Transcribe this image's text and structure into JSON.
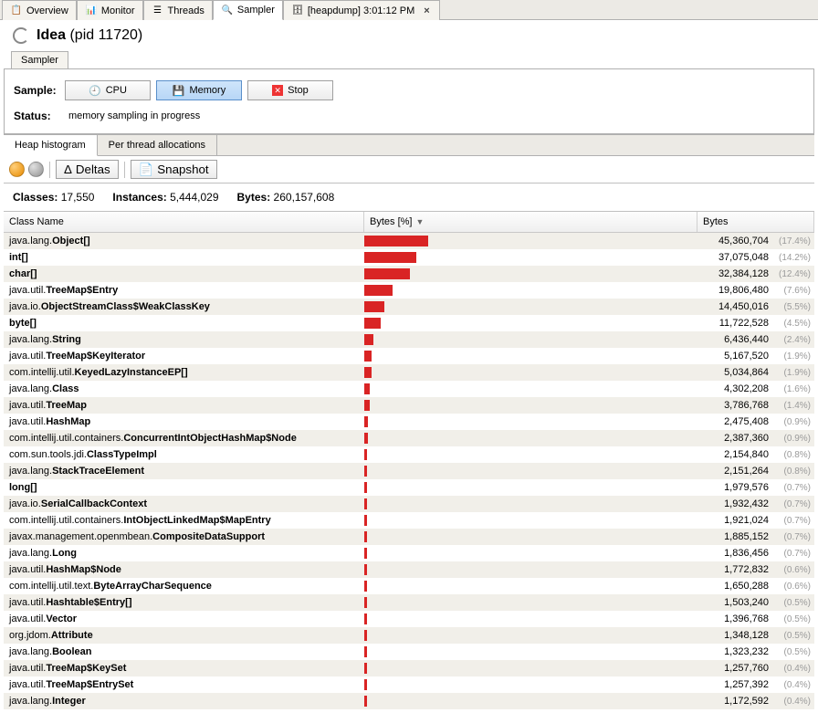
{
  "topTabs": [
    {
      "label": "Overview"
    },
    {
      "label": "Monitor"
    },
    {
      "label": "Threads"
    },
    {
      "label": "Sampler"
    },
    {
      "label": "[heapdump] 3:01:12 PM"
    }
  ],
  "title": {
    "app": "Idea",
    "pid": "(pid 11720)"
  },
  "subTab": "Sampler",
  "sampleLabel": "Sample:",
  "btnCpu": "CPU",
  "btnMemory": "Memory",
  "btnStop": "Stop",
  "statusLabel": "Status:",
  "statusText": "memory sampling in progress",
  "secTabs": {
    "a": "Heap histogram",
    "b": "Per thread allocations"
  },
  "btnDeltas": "Deltas",
  "btnSnapshot": "Snapshot",
  "stats": {
    "classesL": "Classes:",
    "classesV": "17,550",
    "instL": "Instances:",
    "instV": "5,444,029",
    "bytesL": "Bytes:",
    "bytesV": "260,157,608"
  },
  "headers": {
    "name": "Class Name",
    "bar": "Bytes [%]",
    "bytes": "Bytes"
  },
  "rows": [
    {
      "pkg": "java.lang.",
      "cls": "Object[]",
      "bytes": "45,360,704",
      "pct": "(17.4%)",
      "w": 17.4
    },
    {
      "pkg": "",
      "cls": "int[]",
      "bytes": "37,075,048",
      "pct": "(14.2%)",
      "w": 14.2
    },
    {
      "pkg": "",
      "cls": "char[]",
      "bytes": "32,384,128",
      "pct": "(12.4%)",
      "w": 12.4
    },
    {
      "pkg": "java.util.",
      "cls": "TreeMap$Entry",
      "bytes": "19,806,480",
      "pct": "(7.6%)",
      "w": 7.6
    },
    {
      "pkg": "java.io.",
      "cls": "ObjectStreamClass$WeakClassKey",
      "bytes": "14,450,016",
      "pct": "(5.5%)",
      "w": 5.5
    },
    {
      "pkg": "",
      "cls": "byte[]",
      "bytes": "11,722,528",
      "pct": "(4.5%)",
      "w": 4.5
    },
    {
      "pkg": "java.lang.",
      "cls": "String",
      "bytes": "6,436,440",
      "pct": "(2.4%)",
      "w": 2.4
    },
    {
      "pkg": "java.util.",
      "cls": "TreeMap$KeyIterator",
      "bytes": "5,167,520",
      "pct": "(1.9%)",
      "w": 1.9
    },
    {
      "pkg": "com.intellij.util.",
      "cls": "KeyedLazyInstanceEP[]",
      "bytes": "5,034,864",
      "pct": "(1.9%)",
      "w": 1.9
    },
    {
      "pkg": "java.lang.",
      "cls": "Class",
      "bytes": "4,302,208",
      "pct": "(1.6%)",
      "w": 1.6
    },
    {
      "pkg": "java.util.",
      "cls": "TreeMap",
      "bytes": "3,786,768",
      "pct": "(1.4%)",
      "w": 1.4
    },
    {
      "pkg": "java.util.",
      "cls": "HashMap",
      "bytes": "2,475,408",
      "pct": "(0.9%)",
      "w": 0.9
    },
    {
      "pkg": "com.intellij.util.containers.",
      "cls": "ConcurrentIntObjectHashMap$Node",
      "bytes": "2,387,360",
      "pct": "(0.9%)",
      "w": 0.9
    },
    {
      "pkg": "com.sun.tools.jdi.",
      "cls": "ClassTypeImpl",
      "bytes": "2,154,840",
      "pct": "(0.8%)",
      "w": 0.8
    },
    {
      "pkg": "java.lang.",
      "cls": "StackTraceElement",
      "bytes": "2,151,264",
      "pct": "(0.8%)",
      "w": 0.8
    },
    {
      "pkg": "",
      "cls": "long[]",
      "bytes": "1,979,576",
      "pct": "(0.7%)",
      "w": 0.7
    },
    {
      "pkg": "java.io.",
      "cls": "SerialCallbackContext",
      "bytes": "1,932,432",
      "pct": "(0.7%)",
      "w": 0.7
    },
    {
      "pkg": "com.intellij.util.containers.",
      "cls": "IntObjectLinkedMap$MapEntry",
      "bytes": "1,921,024",
      "pct": "(0.7%)",
      "w": 0.7
    },
    {
      "pkg": "javax.management.openmbean.",
      "cls": "CompositeDataSupport",
      "bytes": "1,885,152",
      "pct": "(0.7%)",
      "w": 0.7
    },
    {
      "pkg": "java.lang.",
      "cls": "Long",
      "bytes": "1,836,456",
      "pct": "(0.7%)",
      "w": 0.7
    },
    {
      "pkg": "java.util.",
      "cls": "HashMap$Node",
      "bytes": "1,772,832",
      "pct": "(0.6%)",
      "w": 0.6
    },
    {
      "pkg": "com.intellij.util.text.",
      "cls": "ByteArrayCharSequence",
      "bytes": "1,650,288",
      "pct": "(0.6%)",
      "w": 0.6
    },
    {
      "pkg": "java.util.",
      "cls": "Hashtable$Entry[]",
      "bytes": "1,503,240",
      "pct": "(0.5%)",
      "w": 0.5
    },
    {
      "pkg": "java.util.",
      "cls": "Vector",
      "bytes": "1,396,768",
      "pct": "(0.5%)",
      "w": 0.5
    },
    {
      "pkg": "org.jdom.",
      "cls": "Attribute",
      "bytes": "1,348,128",
      "pct": "(0.5%)",
      "w": 0.5
    },
    {
      "pkg": "java.lang.",
      "cls": "Boolean",
      "bytes": "1,323,232",
      "pct": "(0.5%)",
      "w": 0.5
    },
    {
      "pkg": "java.util.",
      "cls": "TreeMap$KeySet",
      "bytes": "1,257,760",
      "pct": "(0.4%)",
      "w": 0.4
    },
    {
      "pkg": "java.util.",
      "cls": "TreeMap$EntrySet",
      "bytes": "1,257,392",
      "pct": "(0.4%)",
      "w": 0.4
    },
    {
      "pkg": "java.lang.",
      "cls": "Integer",
      "bytes": "1,172,592",
      "pct": "(0.4%)",
      "w": 0.4
    }
  ]
}
